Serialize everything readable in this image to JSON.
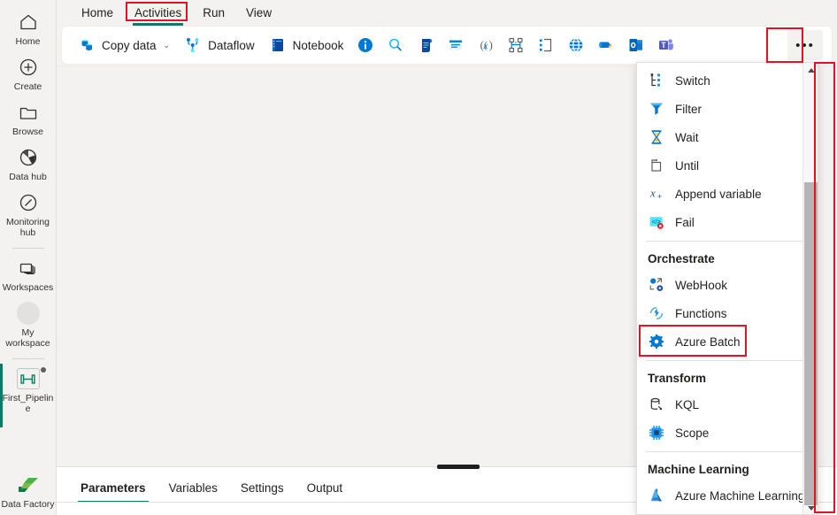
{
  "rail": {
    "items": [
      {
        "label": "Home",
        "icon": "home-icon"
      },
      {
        "label": "Create",
        "icon": "plus-circle-icon"
      },
      {
        "label": "Browse",
        "icon": "folder-icon"
      },
      {
        "label": "Data hub",
        "icon": "data-hub-icon"
      },
      {
        "label": "Monitoring hub",
        "icon": "monitoring-hub-icon"
      },
      {
        "label": "Workspaces",
        "icon": "workspaces-icon"
      },
      {
        "label": "My workspace",
        "icon": "avatar-icon"
      },
      {
        "label": "First_Pipeline",
        "icon": "pipeline-icon"
      }
    ],
    "bottom": {
      "label": "Data Factory",
      "icon": "data-factory-icon"
    }
  },
  "tabs": {
    "items": [
      {
        "label": "Home",
        "active": false
      },
      {
        "label": "Activities",
        "active": true
      },
      {
        "label": "Run",
        "active": false
      },
      {
        "label": "View",
        "active": false
      }
    ],
    "highlighted": "Activities"
  },
  "toolbar": {
    "copy_data": {
      "label": "Copy data",
      "icon": "copy-data-icon",
      "chevron": "⌄"
    },
    "dataflow": {
      "label": "Dataflow",
      "icon": "dataflow-icon"
    },
    "notebook": {
      "label": "Notebook",
      "icon": "notebook-icon"
    },
    "icon_buttons": [
      {
        "name": "get-metadata-icon",
        "title": "Get metadata"
      },
      {
        "name": "lookup-icon",
        "title": "Lookup"
      },
      {
        "name": "script-icon",
        "title": "Script"
      },
      {
        "name": "stored-procedure-icon",
        "title": "Stored procedure"
      },
      {
        "name": "set-variable-icon",
        "title": "Set variable"
      },
      {
        "name": "if-condition-icon",
        "title": "If condition"
      },
      {
        "name": "foreach-icon",
        "title": "ForEach"
      },
      {
        "name": "web-icon",
        "title": "Web"
      },
      {
        "name": "webhook-activity-icon",
        "title": "Webhook"
      },
      {
        "name": "office365-outlook-icon",
        "title": "Office 365 Outlook"
      },
      {
        "name": "teams-icon",
        "title": "Teams"
      }
    ],
    "more_label": "•••"
  },
  "menu": {
    "groups": [
      {
        "header": null,
        "items": [
          {
            "label": "Switch",
            "icon": "switch-icon"
          },
          {
            "label": "Filter",
            "icon": "filter-icon"
          },
          {
            "label": "Wait",
            "icon": "wait-icon"
          },
          {
            "label": "Until",
            "icon": "until-icon"
          },
          {
            "label": "Append variable",
            "icon": "append-variable-icon"
          },
          {
            "label": "Fail",
            "icon": "fail-icon"
          }
        ]
      },
      {
        "header": "Orchestrate",
        "items": [
          {
            "label": "WebHook",
            "icon": "webhook-icon"
          },
          {
            "label": "Functions",
            "icon": "functions-icon"
          },
          {
            "label": "Azure Batch",
            "icon": "azure-batch-icon",
            "highlighted": true
          }
        ]
      },
      {
        "header": "Transform",
        "items": [
          {
            "label": "KQL",
            "icon": "kql-icon"
          },
          {
            "label": "Scope",
            "icon": "scope-icon"
          }
        ]
      },
      {
        "header": "Machine Learning",
        "items": [
          {
            "label": "Azure Machine Learning",
            "icon": "azure-ml-icon"
          }
        ]
      }
    ],
    "scrollbar": {
      "up_arrow": "▲",
      "down_arrow": "▼"
    }
  },
  "bottom_panel": {
    "tabs": [
      {
        "label": "Parameters",
        "active": true
      },
      {
        "label": "Variables",
        "active": false
      },
      {
        "label": "Settings",
        "active": false
      },
      {
        "label": "Output",
        "active": false
      }
    ]
  },
  "colors": {
    "accent_teal": "#117865",
    "highlight_red": "#e81123",
    "azure_blue": "#0078d4",
    "chrome_bg": "#f3f2f1"
  }
}
